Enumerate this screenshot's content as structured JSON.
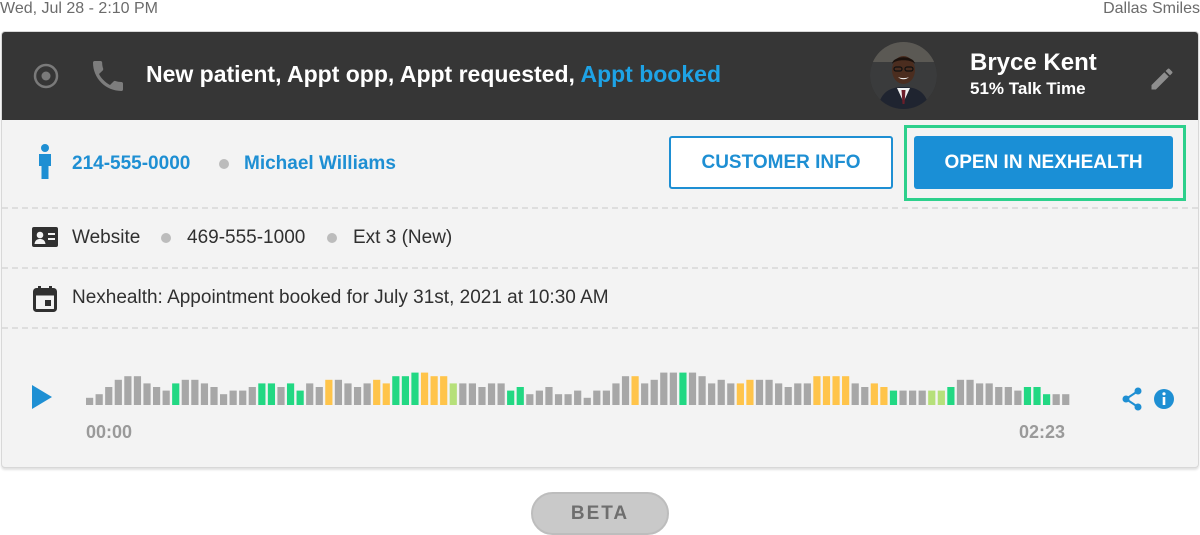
{
  "topbar": {
    "datetime": "Wed, Jul 28 - 2:10 PM",
    "practice": "Dallas Smiles"
  },
  "header": {
    "title_prefix": "New patient, Appt opp, Appt requested,",
    "title_highlight": "Appt booked",
    "agent_name": "Bryce Kent",
    "agent_sub": "51% Talk Time",
    "icons": [
      "record-circle-icon",
      "phone-icon",
      "edit-pencil-icon"
    ]
  },
  "caller": {
    "phone": "214-555-0000",
    "name": "Michael Williams",
    "customer_info_button": "CUSTOMER INFO",
    "open_button": "OPEN IN NEXHEALTH"
  },
  "source": {
    "channel": "Website",
    "number": "469-555-1000",
    "extension": "Ext 3 (New)"
  },
  "event": {
    "text": "Nexhealth: Appointment booked for July 31st, 2021 at 10:30 AM"
  },
  "player": {
    "start_time": "00:00",
    "end_time": "02:23",
    "colors": {
      "gray": "#a7a7a7",
      "green": "#22d883",
      "orange": "#ffc44a",
      "lime": "#b6e07a"
    },
    "levels": [
      2,
      3,
      5,
      7,
      8,
      8,
      6,
      5,
      4,
      6,
      7,
      7,
      6,
      5,
      3,
      4,
      4,
      5,
      6,
      6,
      5,
      6,
      4,
      6,
      5,
      7,
      7,
      6,
      5,
      6,
      7,
      6,
      8,
      8,
      9,
      9,
      8,
      8,
      6,
      6,
      6,
      5,
      6,
      6,
      4,
      5,
      3,
      4,
      5,
      3,
      3,
      4,
      2,
      4,
      4,
      6,
      8,
      8,
      6,
      7,
      9,
      9,
      9,
      9,
      8,
      6,
      7,
      6,
      6,
      7,
      7,
      7,
      6,
      5,
      6,
      6,
      8,
      8,
      8,
      8,
      6,
      5,
      6,
      5,
      4,
      4,
      4,
      4,
      4,
      4,
      5,
      7,
      7,
      6,
      6,
      5,
      5,
      4,
      5,
      5,
      3,
      3,
      3
    ],
    "bar_colors": [
      "gray",
      "gray",
      "gray",
      "gray",
      "gray",
      "gray",
      "gray",
      "gray",
      "gray",
      "green",
      "gray",
      "gray",
      "gray",
      "gray",
      "gray",
      "gray",
      "gray",
      "gray",
      "green",
      "green",
      "gray",
      "green",
      "green",
      "gray",
      "gray",
      "orange",
      "gray",
      "gray",
      "gray",
      "gray",
      "orange",
      "orange",
      "green",
      "green",
      "green",
      "orange",
      "orange",
      "orange",
      "lime",
      "gray",
      "gray",
      "gray",
      "gray",
      "gray",
      "green",
      "green",
      "gray",
      "gray",
      "gray",
      "gray",
      "gray",
      "gray",
      "gray",
      "gray",
      "gray",
      "gray",
      "gray",
      "orange",
      "gray",
      "gray",
      "gray",
      "gray",
      "green",
      "gray",
      "gray",
      "gray",
      "gray",
      "gray",
      "orange",
      "orange",
      "gray",
      "gray",
      "gray",
      "gray",
      "gray",
      "gray",
      "orange",
      "orange",
      "orange",
      "orange",
      "gray",
      "gray",
      "orange",
      "orange",
      "green",
      "gray",
      "gray",
      "gray",
      "lime",
      "lime",
      "green",
      "gray",
      "gray",
      "gray",
      "gray",
      "gray",
      "gray",
      "gray",
      "green",
      "green",
      "green",
      "gray",
      "gray",
      "gray"
    ]
  },
  "beta_label": "BETA"
}
